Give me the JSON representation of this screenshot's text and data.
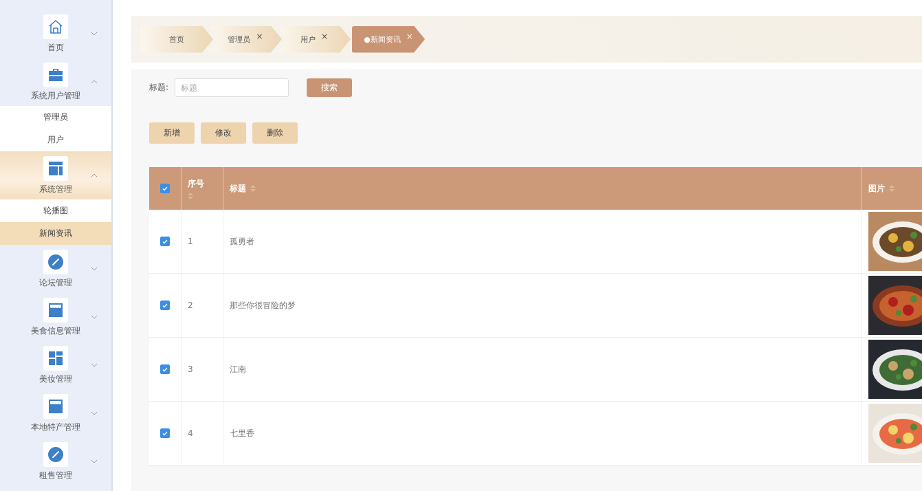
{
  "sidebar": {
    "items": [
      {
        "label": "首页",
        "expanded": false,
        "selected": false
      },
      {
        "label": "系统用户管理",
        "expanded": true,
        "selected": false,
        "children": [
          {
            "label": "管理员",
            "selected": false
          },
          {
            "label": "用户",
            "selected": false
          }
        ]
      },
      {
        "label": "系统管理",
        "expanded": true,
        "selected": true,
        "children": [
          {
            "label": "轮播图",
            "selected": false
          },
          {
            "label": "新闻资讯",
            "selected": true
          }
        ]
      },
      {
        "label": "论坛管理",
        "expanded": false,
        "selected": false
      },
      {
        "label": "美食信息管理",
        "expanded": false,
        "selected": false
      },
      {
        "label": "美妆管理",
        "expanded": false,
        "selected": false
      },
      {
        "label": "本地特产管理",
        "expanded": false,
        "selected": false
      },
      {
        "label": "租售管理",
        "expanded": false,
        "selected": false
      }
    ]
  },
  "tabs": [
    {
      "label": "首页",
      "selected": false
    },
    {
      "label": "管理员",
      "close": "×",
      "selected": false
    },
    {
      "label": "用户",
      "close": "×",
      "selected": false
    },
    {
      "label": "●新闻资讯",
      "close": "×",
      "selected": true
    }
  ],
  "search": {
    "label": "标题:",
    "placeholder": "标题",
    "button": "搜索"
  },
  "actions": [
    "新增",
    "修改",
    "删除"
  ],
  "table": {
    "all_checked": true,
    "columns": [
      {
        "label": "序号"
      },
      {
        "label": "标题"
      },
      {
        "label": "图片"
      }
    ],
    "rows": [
      {
        "checked": true,
        "index": "1",
        "title": "孤勇者"
      },
      {
        "checked": true,
        "index": "2",
        "title": "那些你很冒险的梦"
      },
      {
        "checked": true,
        "index": "3",
        "title": "江南"
      },
      {
        "checked": true,
        "index": "4",
        "title": "七里香"
      }
    ]
  }
}
